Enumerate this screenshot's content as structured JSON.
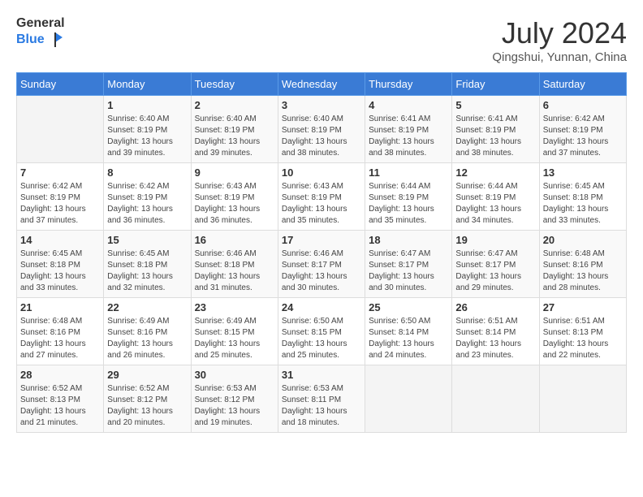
{
  "header": {
    "logo_general": "General",
    "logo_blue": "Blue",
    "month_title": "July 2024",
    "location": "Qingshui, Yunnan, China"
  },
  "days_of_week": [
    "Sunday",
    "Monday",
    "Tuesday",
    "Wednesday",
    "Thursday",
    "Friday",
    "Saturday"
  ],
  "weeks": [
    [
      {
        "day": "",
        "info": ""
      },
      {
        "day": "1",
        "info": "Sunrise: 6:40 AM\nSunset: 8:19 PM\nDaylight: 13 hours\nand 39 minutes."
      },
      {
        "day": "2",
        "info": "Sunrise: 6:40 AM\nSunset: 8:19 PM\nDaylight: 13 hours\nand 39 minutes."
      },
      {
        "day": "3",
        "info": "Sunrise: 6:40 AM\nSunset: 8:19 PM\nDaylight: 13 hours\nand 38 minutes."
      },
      {
        "day": "4",
        "info": "Sunrise: 6:41 AM\nSunset: 8:19 PM\nDaylight: 13 hours\nand 38 minutes."
      },
      {
        "day": "5",
        "info": "Sunrise: 6:41 AM\nSunset: 8:19 PM\nDaylight: 13 hours\nand 38 minutes."
      },
      {
        "day": "6",
        "info": "Sunrise: 6:42 AM\nSunset: 8:19 PM\nDaylight: 13 hours\nand 37 minutes."
      }
    ],
    [
      {
        "day": "7",
        "info": "Sunrise: 6:42 AM\nSunset: 8:19 PM\nDaylight: 13 hours\nand 37 minutes."
      },
      {
        "day": "8",
        "info": "Sunrise: 6:42 AM\nSunset: 8:19 PM\nDaylight: 13 hours\nand 36 minutes."
      },
      {
        "day": "9",
        "info": "Sunrise: 6:43 AM\nSunset: 8:19 PM\nDaylight: 13 hours\nand 36 minutes."
      },
      {
        "day": "10",
        "info": "Sunrise: 6:43 AM\nSunset: 8:19 PM\nDaylight: 13 hours\nand 35 minutes."
      },
      {
        "day": "11",
        "info": "Sunrise: 6:44 AM\nSunset: 8:19 PM\nDaylight: 13 hours\nand 35 minutes."
      },
      {
        "day": "12",
        "info": "Sunrise: 6:44 AM\nSunset: 8:19 PM\nDaylight: 13 hours\nand 34 minutes."
      },
      {
        "day": "13",
        "info": "Sunrise: 6:45 AM\nSunset: 8:18 PM\nDaylight: 13 hours\nand 33 minutes."
      }
    ],
    [
      {
        "day": "14",
        "info": "Sunrise: 6:45 AM\nSunset: 8:18 PM\nDaylight: 13 hours\nand 33 minutes."
      },
      {
        "day": "15",
        "info": "Sunrise: 6:45 AM\nSunset: 8:18 PM\nDaylight: 13 hours\nand 32 minutes."
      },
      {
        "day": "16",
        "info": "Sunrise: 6:46 AM\nSunset: 8:18 PM\nDaylight: 13 hours\nand 31 minutes."
      },
      {
        "day": "17",
        "info": "Sunrise: 6:46 AM\nSunset: 8:17 PM\nDaylight: 13 hours\nand 30 minutes."
      },
      {
        "day": "18",
        "info": "Sunrise: 6:47 AM\nSunset: 8:17 PM\nDaylight: 13 hours\nand 30 minutes."
      },
      {
        "day": "19",
        "info": "Sunrise: 6:47 AM\nSunset: 8:17 PM\nDaylight: 13 hours\nand 29 minutes."
      },
      {
        "day": "20",
        "info": "Sunrise: 6:48 AM\nSunset: 8:16 PM\nDaylight: 13 hours\nand 28 minutes."
      }
    ],
    [
      {
        "day": "21",
        "info": "Sunrise: 6:48 AM\nSunset: 8:16 PM\nDaylight: 13 hours\nand 27 minutes."
      },
      {
        "day": "22",
        "info": "Sunrise: 6:49 AM\nSunset: 8:16 PM\nDaylight: 13 hours\nand 26 minutes."
      },
      {
        "day": "23",
        "info": "Sunrise: 6:49 AM\nSunset: 8:15 PM\nDaylight: 13 hours\nand 25 minutes."
      },
      {
        "day": "24",
        "info": "Sunrise: 6:50 AM\nSunset: 8:15 PM\nDaylight: 13 hours\nand 25 minutes."
      },
      {
        "day": "25",
        "info": "Sunrise: 6:50 AM\nSunset: 8:14 PM\nDaylight: 13 hours\nand 24 minutes."
      },
      {
        "day": "26",
        "info": "Sunrise: 6:51 AM\nSunset: 8:14 PM\nDaylight: 13 hours\nand 23 minutes."
      },
      {
        "day": "27",
        "info": "Sunrise: 6:51 AM\nSunset: 8:13 PM\nDaylight: 13 hours\nand 22 minutes."
      }
    ],
    [
      {
        "day": "28",
        "info": "Sunrise: 6:52 AM\nSunset: 8:13 PM\nDaylight: 13 hours\nand 21 minutes."
      },
      {
        "day": "29",
        "info": "Sunrise: 6:52 AM\nSunset: 8:12 PM\nDaylight: 13 hours\nand 20 minutes."
      },
      {
        "day": "30",
        "info": "Sunrise: 6:53 AM\nSunset: 8:12 PM\nDaylight: 13 hours\nand 19 minutes."
      },
      {
        "day": "31",
        "info": "Sunrise: 6:53 AM\nSunset: 8:11 PM\nDaylight: 13 hours\nand 18 minutes."
      },
      {
        "day": "",
        "info": ""
      },
      {
        "day": "",
        "info": ""
      },
      {
        "day": "",
        "info": ""
      }
    ]
  ]
}
